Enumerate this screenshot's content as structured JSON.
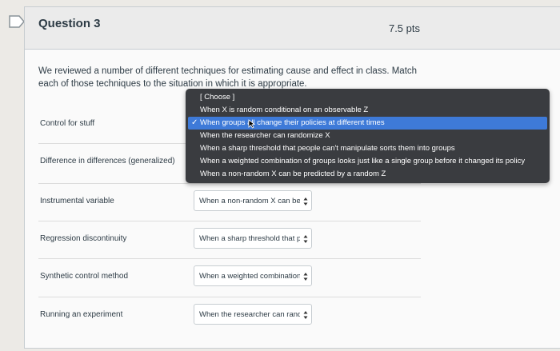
{
  "question": {
    "title": "Question 3",
    "points": "7.5 pts",
    "text": "We reviewed a number of different techniques for estimating cause and effect in class. Match each of those techniques to the situation in which it is appropriate."
  },
  "rows": [
    {
      "label": "Control for stuff",
      "selected": ""
    },
    {
      "label": "Difference in differences (generalized)",
      "selected": ""
    },
    {
      "label": "Instrumental variable",
      "selected": "When a non-random X can be"
    },
    {
      "label": "Regression discontinuity",
      "selected": "When a sharp threshold that p"
    },
    {
      "label": "Synthetic control method",
      "selected": "When a weighted combination"
    },
    {
      "label": "Running an experiment",
      "selected": "When the researcher can rand·"
    }
  ],
  "dropdown": {
    "options": [
      "[ Choose ]",
      "When X is random conditional on an observable Z",
      "When groups all change their policies at different times",
      "When the researcher can randomize X",
      "When a sharp threshold that people can't manipulate sorts them into groups",
      "When a weighted combination of groups looks just like a single group before it changed its policy",
      "When a non-random X can be predicted by a random Z"
    ],
    "selected_index": 2,
    "check_glyph": "✓"
  },
  "colors": {
    "highlight": "#3e7ad8",
    "menu_bg": "#3a3c40"
  }
}
